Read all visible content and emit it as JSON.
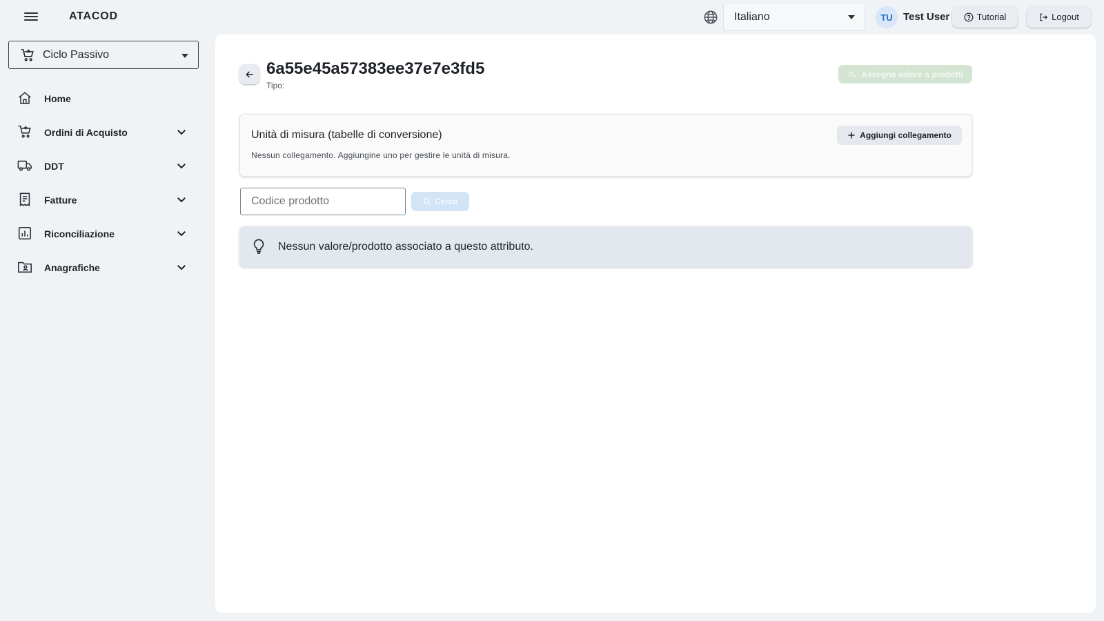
{
  "app": {
    "brand": "ATACOD"
  },
  "header": {
    "language": {
      "selected": "Italiano"
    },
    "user": {
      "initials": "TU",
      "name": "Test User"
    },
    "tutorial_label": "Tutorial",
    "logout_label": "Logout"
  },
  "sidebar": {
    "module": {
      "selected": "Ciclo Passivo"
    },
    "items": [
      {
        "label": "Home",
        "icon": "home-icon",
        "expandable": false
      },
      {
        "label": "Ordini di Acquisto",
        "icon": "cart-icon",
        "expandable": true
      },
      {
        "label": "DDT",
        "icon": "truck-icon",
        "expandable": true
      },
      {
        "label": "Fatture",
        "icon": "invoice-icon",
        "expandable": true
      },
      {
        "label": "Riconciliazione",
        "icon": "analytics-icon",
        "expandable": true
      },
      {
        "label": "Anagrafiche",
        "icon": "contact-folder-icon",
        "expandable": true
      }
    ]
  },
  "main": {
    "title": "6a55e45a57383ee37e7e3fd5",
    "subtitle": "Tipo:",
    "assign_label": "Assegna valore a prodotti",
    "uom": {
      "title": "Unità di misura (tabelle di conversione)",
      "description": "Nessun collegamento. Aggiungine uno per gestire le unità di misura.",
      "add_label": "Aggiungi collegamento"
    },
    "search": {
      "placeholder": "Codice prodotto",
      "value": "",
      "button_label": "Cerca"
    },
    "info_message": "Nessun valore/prodotto associato a questo attributo."
  },
  "colors": {
    "background": "#f0f3f6",
    "panel": "#ffffff",
    "avatar_bg": "#d7e6f8",
    "avatar_text": "#2d6cc5",
    "assign_disabled": "#d4e4d3",
    "search_disabled": "#d3e4f7",
    "info_banner": "#e3e8ef"
  }
}
